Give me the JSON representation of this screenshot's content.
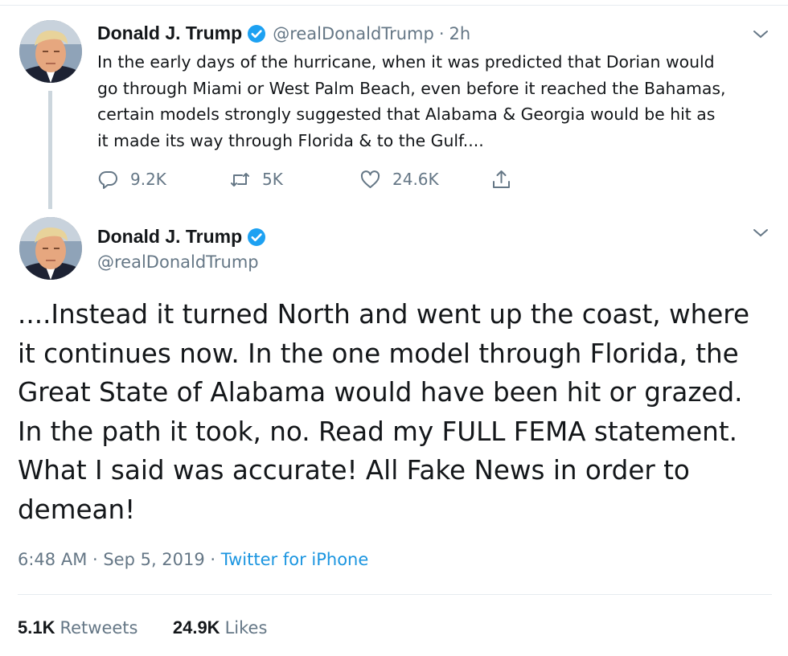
{
  "colors": {
    "verified": "#1da1f2",
    "muted": "#657786",
    "link": "#1b95e0",
    "text": "#14171a",
    "thread": "#ccd6dd"
  },
  "tweet1": {
    "avatar_icon": "profile-photo",
    "name": "Donald J. Trump",
    "handle": "@realDonaldTrump",
    "separator": "·",
    "time": "2h",
    "text_lines": [
      "In the early days of the hurricane, when it was predicted that Dorian would",
      "go through Miami or West Palm Beach, even before it reached the Bahamas,",
      "certain models strongly suggested that Alabama & Georgia would be hit as",
      "it made its way through Florida & to the Gulf...."
    ],
    "replies": "9.2K",
    "retweets": "5K",
    "likes": "24.6K"
  },
  "tweet2": {
    "name": "Donald J. Trump",
    "handle": "@realDonaldTrump",
    "text_lines": [
      "....Instead it turned North and went up the coast, where",
      "it continues now. In the one model through Florida, the",
      "Great State of Alabama would have been hit or grazed.",
      "In the path it took, no. Read my FULL FEMA statement.",
      "What I said was accurate! All Fake News in order to",
      "demean!"
    ],
    "timestamp": "6:48 AM · Sep 5, 2019 · ",
    "source": "Twitter for iPhone",
    "retweets_count": "5.1K",
    "retweets_label": "Retweets",
    "likes_count": "24.9K",
    "likes_label": "Likes"
  }
}
